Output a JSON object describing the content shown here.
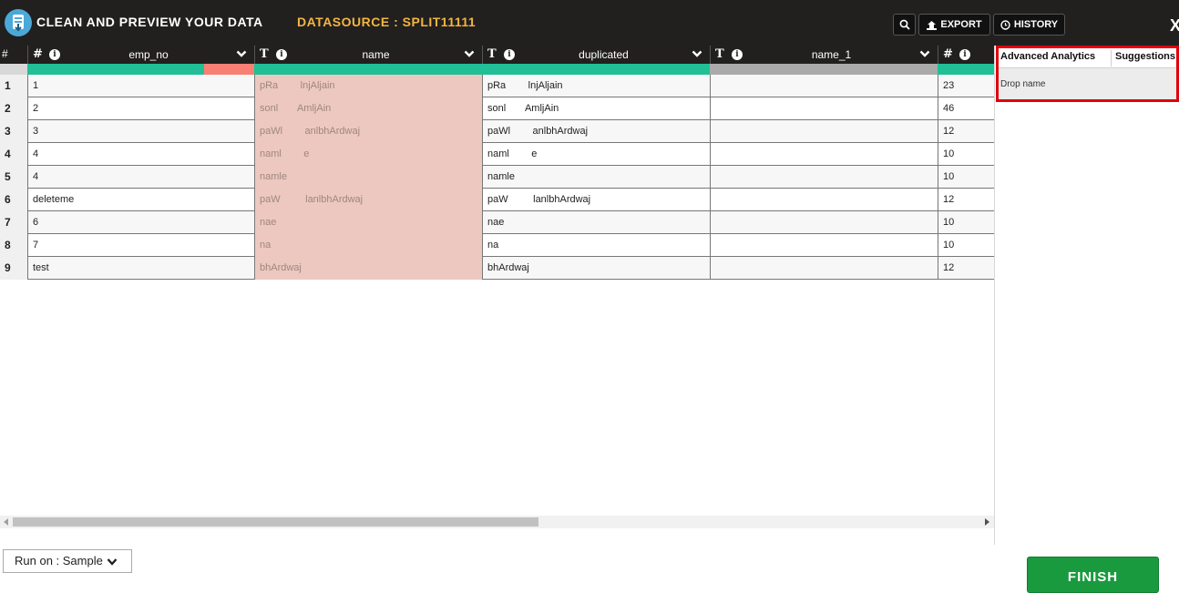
{
  "header": {
    "app_title": "CLEAN AND PREVIEW YOUR DATA",
    "datasource_label": "DATASOURCE : SPLIT11111",
    "export_label": "EXPORT",
    "history_label": "HISTORY",
    "close_label": "X"
  },
  "grid": {
    "rownum_header": "#",
    "columns": [
      {
        "type": "#",
        "name": "emp_no"
      },
      {
        "type": "T",
        "name": "name"
      },
      {
        "type": "T",
        "name": "duplicated"
      },
      {
        "type": "T",
        "name": "name_1"
      },
      {
        "type": "#",
        "name": ""
      }
    ],
    "quality_colors": {
      "valid": "#20bf96",
      "invalid": "#f97f74",
      "empty": "#aaaaaa"
    },
    "rows": [
      {
        "n": "1",
        "cells": [
          "1",
          "pRa        lnjAljain",
          "pRa        lnjAljain",
          "",
          "23"
        ]
      },
      {
        "n": "2",
        "cells": [
          "2",
          "sonl       AmljAin",
          "sonl       AmljAin",
          "",
          "46"
        ]
      },
      {
        "n": "3",
        "cells": [
          "3",
          "paWl        anlbhArdwaj",
          "paWl        anlbhArdwaj",
          "",
          "12"
        ]
      },
      {
        "n": "4",
        "cells": [
          "4",
          "naml        e",
          "naml        e",
          "",
          "10"
        ]
      },
      {
        "n": "5",
        "cells": [
          "4",
          "namle",
          "namle",
          "",
          "10"
        ]
      },
      {
        "n": "6",
        "cells": [
          "deleteme",
          "paW         lanlbhArdwaj",
          "paW         lanlbhArdwaj",
          "",
          "12"
        ]
      },
      {
        "n": "7",
        "cells": [
          "6",
          "nae",
          "nae",
          "",
          "10"
        ]
      },
      {
        "n": "8",
        "cells": [
          "7",
          "na",
          "na",
          "",
          "10"
        ]
      },
      {
        "n": "9",
        "cells": [
          "test",
          "bhArdwaj",
          "bhArdwaj",
          "",
          "12"
        ]
      }
    ]
  },
  "panel": {
    "tab_advanced": "Advanced Analytics",
    "tab_suggestions": "Suggestions",
    "suggestion_item": "Drop name"
  },
  "footer": {
    "run_on_label": "Run on : Sample",
    "finish_label": "FINISH"
  }
}
